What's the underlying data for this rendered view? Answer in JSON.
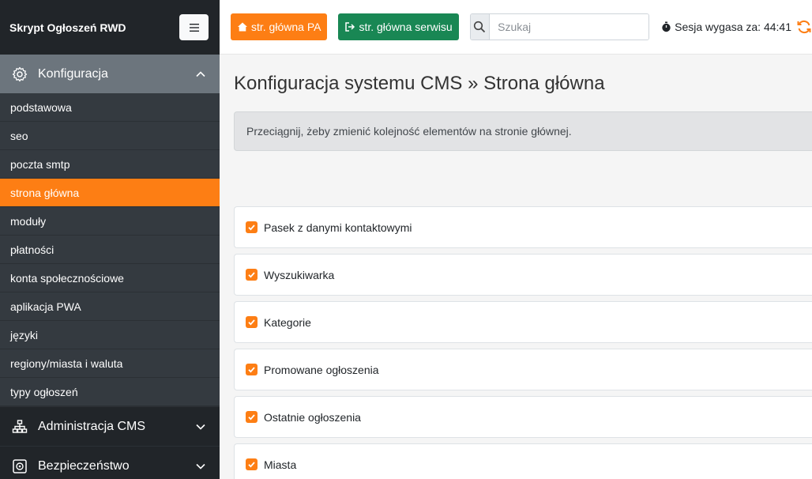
{
  "sidebar": {
    "brand": "Skrypt Ogłoszeń RWD",
    "open_section": {
      "label": "Konfiguracja",
      "icon": "gear-icon",
      "items": [
        {
          "label": "podstawowa",
          "active": false
        },
        {
          "label": "seo",
          "active": false
        },
        {
          "label": "poczta smtp",
          "active": false
        },
        {
          "label": "strona główna",
          "active": true
        },
        {
          "label": "moduły",
          "active": false
        },
        {
          "label": "płatności",
          "active": false
        },
        {
          "label": "konta społecznościowe",
          "active": false
        },
        {
          "label": "aplikacja PWA",
          "active": false
        },
        {
          "label": "języki",
          "active": false
        },
        {
          "label": "regiony/miasta i waluta",
          "active": false
        },
        {
          "label": "typy ogłoszeń",
          "active": false
        }
      ]
    },
    "closed_sections": [
      {
        "label": "Administracja CMS",
        "icon": "sitemap-icon"
      },
      {
        "label": "Bezpieczeństwo",
        "icon": "safe-icon"
      }
    ]
  },
  "topbar": {
    "home_pa_label": "str. główna PA",
    "home_site_label": "str. główna serwisu",
    "search_placeholder": "Szukaj",
    "session_text": "Sesja wygasa za: 44:41"
  },
  "main": {
    "title": "Konfiguracja systemu CMS » Strona główna",
    "alert": "Przeciągnij, żeby zmienić kolejność elementów na stronie głównej.",
    "items": [
      {
        "label": "Pasek z danymi kontaktowymi",
        "checked": true
      },
      {
        "label": "Wyszukiwarka",
        "checked": true
      },
      {
        "label": "Kategorie",
        "checked": true
      },
      {
        "label": "Promowane ogłoszenia",
        "checked": true
      },
      {
        "label": "Ostatnie ogłoszenia",
        "checked": true
      },
      {
        "label": "Miasta",
        "checked": true
      }
    ]
  },
  "colors": {
    "accent_orange": "#fd7e14",
    "success_green": "#198754",
    "sidebar_bg": "#343a40"
  }
}
